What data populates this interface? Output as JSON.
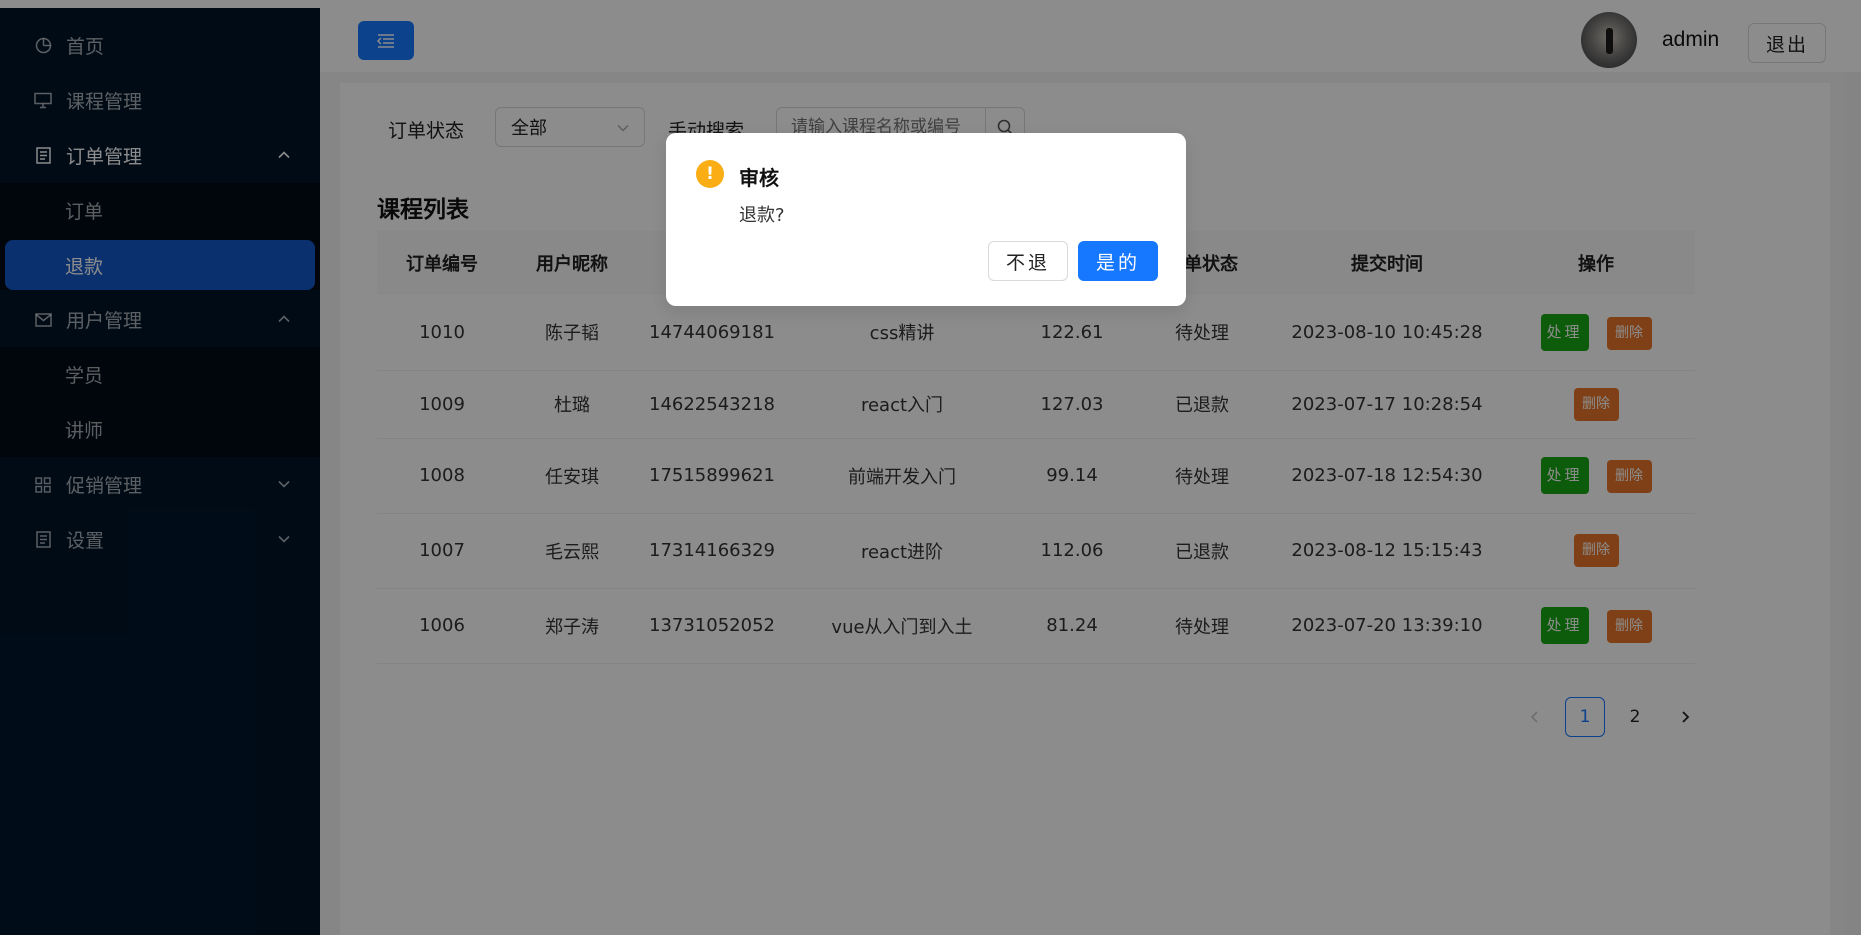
{
  "sidebar": {
    "items": [
      {
        "label": "首页",
        "icon": "pie-chart-icon"
      },
      {
        "label": "课程管理",
        "icon": "desktop-icon"
      },
      {
        "label": "订单管理",
        "icon": "file-icon",
        "submenu": [
          {
            "label": "订单"
          },
          {
            "label": "退款"
          }
        ]
      },
      {
        "label": "用户管理",
        "icon": "mail-icon",
        "submenu": [
          {
            "label": "学员"
          },
          {
            "label": "讲师"
          }
        ]
      },
      {
        "label": "促销管理",
        "icon": "appstore-icon"
      },
      {
        "label": "设置",
        "icon": "file-icon"
      }
    ]
  },
  "header": {
    "username": "admin",
    "logout_label": "退出"
  },
  "filters": {
    "status_label": "订单状态",
    "status_value": "全部",
    "search_label": "手动搜索",
    "search_placeholder": "请输入课程名称或编号"
  },
  "list": {
    "title": "课程列表",
    "columns": [
      "订单编号",
      "用户昵称",
      "",
      "",
      "",
      "订单状态",
      "提交时间",
      "操作"
    ],
    "rows": [
      {
        "id": "1010",
        "nickname": "陈子韬",
        "phone": "14744069181",
        "course": "css精讲",
        "amount": "122.61",
        "status": "待处理",
        "time": "2023-08-10 10:45:28"
      },
      {
        "id": "1009",
        "nickname": "杜璐",
        "phone": "14622543218",
        "course": "react入门",
        "amount": "127.03",
        "status": "已退款",
        "time": "2023-07-17 10:28:54"
      },
      {
        "id": "1008",
        "nickname": "任安琪",
        "phone": "17515899621",
        "course": "前端开发入门",
        "amount": "99.14",
        "status": "待处理",
        "time": "2023-07-18 12:54:30"
      },
      {
        "id": "1007",
        "nickname": "毛云熙",
        "phone": "17314166329",
        "course": "react进阶",
        "amount": "112.06",
        "status": "已退款",
        "time": "2023-08-12 15:15:43"
      },
      {
        "id": "1006",
        "nickname": "郑子涛",
        "phone": "13731052052",
        "course": "vue从入门到入土",
        "amount": "81.24",
        "status": "待处理",
        "time": "2023-07-20 13:39:10"
      }
    ],
    "actions": {
      "handle": "处理",
      "delete": "删除"
    }
  },
  "pagination": {
    "pages": [
      "1",
      "2"
    ],
    "current": "1"
  },
  "modal": {
    "title": "审核",
    "content": "退款?",
    "cancel_label": "不退",
    "ok_label": "是的"
  },
  "colors": {
    "sidebar_bg": "#001529",
    "primary": "#1677ff",
    "handle_button": "#18a814",
    "delete_button": "#e8762a",
    "warning": "#faad14"
  }
}
